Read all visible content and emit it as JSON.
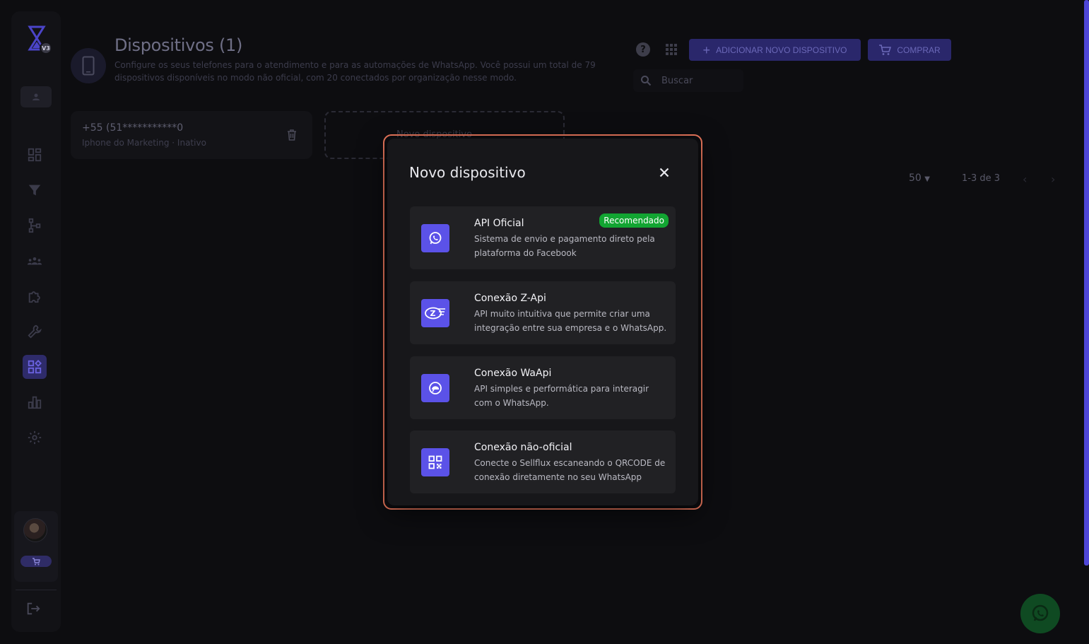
{
  "sidebar": {
    "logo_badge": "V3",
    "nav_icons": [
      "dashboard-icon",
      "funnel-icon",
      "flow-icon",
      "contacts-icon",
      "puzzle-icon",
      "wrench-icon",
      "devices-icon",
      "chart-icon",
      "settings-icon"
    ],
    "active_item": "devices-icon"
  },
  "header": {
    "title": "Dispositivos (1)",
    "description": "Configure os seus telefones para o atendimento e para as automações de WhatsApp. Você possui um total de 79 dispositivos disponíveis no modo não oficial, com 20 conectados por organização nesse modo.",
    "add_button_label": "ADICIONAR NOVO DISPOSITIVO",
    "buy_button_label": "COMPRAR",
    "search_placeholder": "Buscar"
  },
  "devices": [
    {
      "number": "+55 (51***********0",
      "subtitle": "Iphone do Marketing · Inativo"
    }
  ],
  "new_device_label": "Novo dispositivo",
  "pagination": {
    "per_page": "50",
    "range": "1-3 de 3"
  },
  "modal": {
    "title": "Novo dispositivo",
    "options": [
      {
        "title": "API Oficial",
        "description": "Sistema de envio e pagamento direto pela plataforma do Facebook",
        "badge": "Recomendado",
        "icon": "whatsapp-icon"
      },
      {
        "title": "Conexão Z-Api",
        "description": "API muito intuitiva que permite criar uma integração entre sua empresa e o WhatsApp.",
        "icon": "zapi-icon"
      },
      {
        "title": "Conexão WaApi",
        "description": "API simples e performática para interagir com o WhatsApp.",
        "icon": "chat-bubble-icon"
      },
      {
        "title": "Conexão não-oficial",
        "description": "Conecte o Sellflux escaneando o QRCODE de conexão diretamente no seu WhatsApp",
        "icon": "qrcode-icon"
      }
    ]
  },
  "colors": {
    "accent": "#5b52e8",
    "badge_green": "#12a532",
    "highlight_ring": "#f07a5e"
  }
}
